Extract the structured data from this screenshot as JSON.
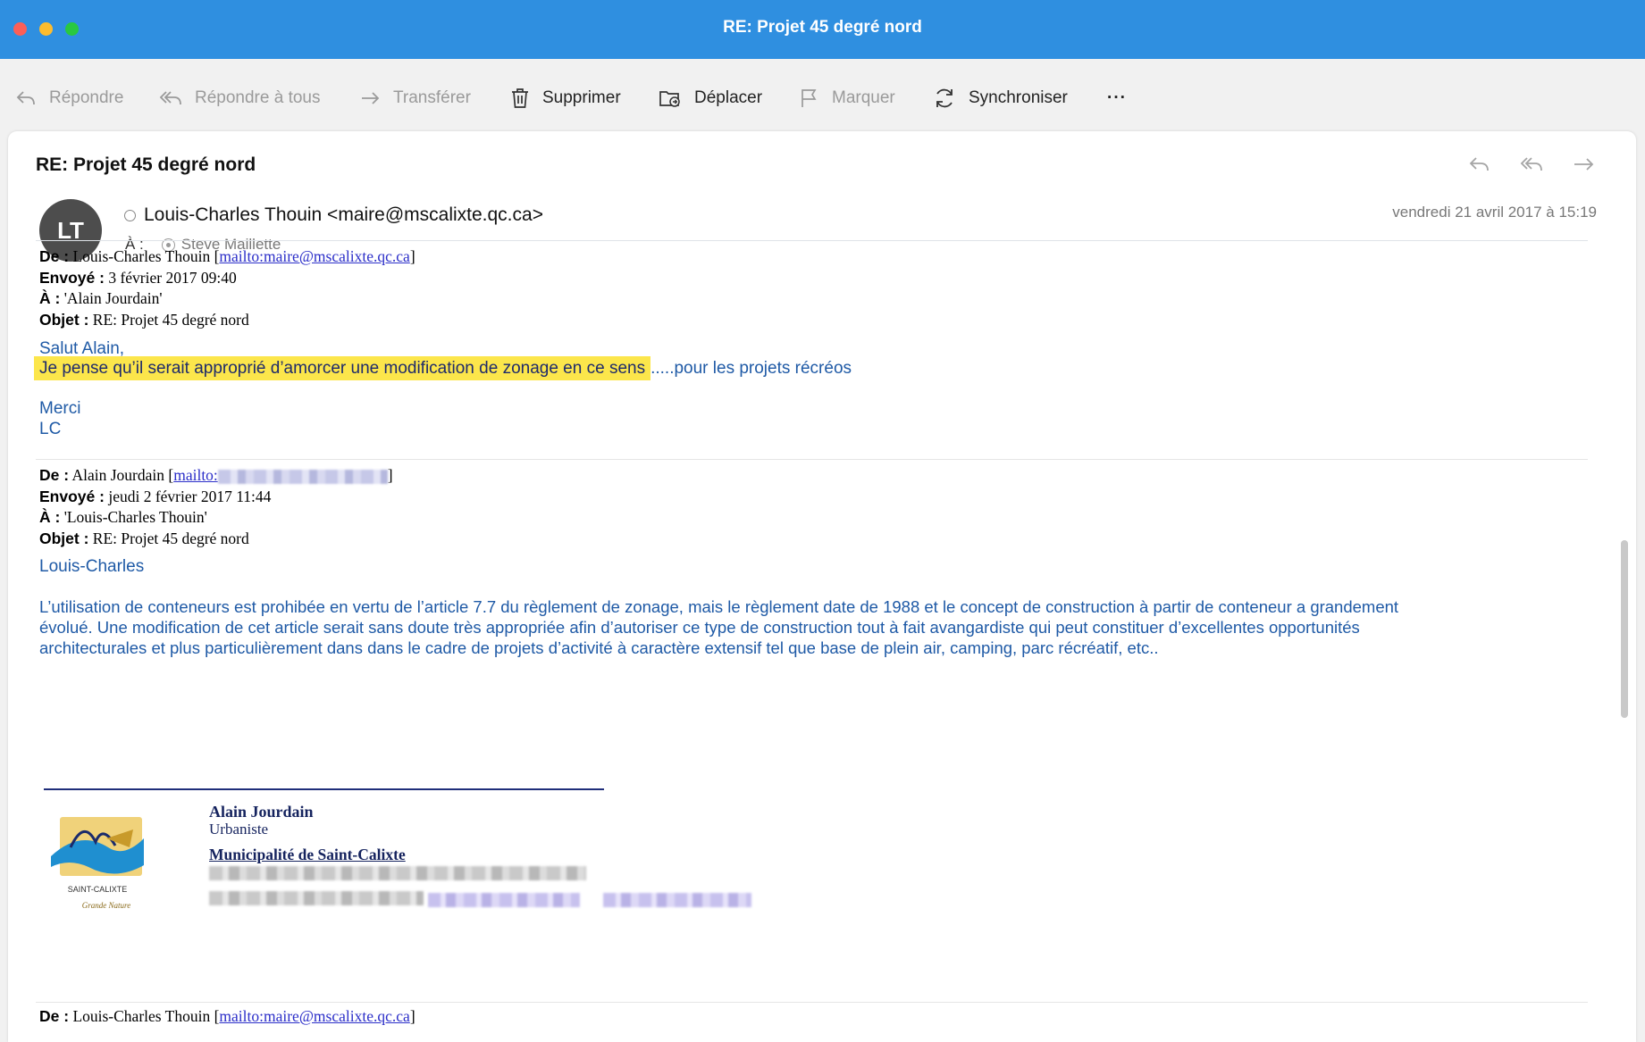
{
  "window": {
    "title": "RE: Projet 45 degré nord"
  },
  "toolbar": {
    "reply": "Répondre",
    "reply_all": "Répondre à tous",
    "forward": "Transférer",
    "delete": "Supprimer",
    "move": "Déplacer",
    "flag": "Marquer",
    "sync": "Synchroniser",
    "more": "···"
  },
  "message": {
    "subject": "RE: Projet 45 degré nord",
    "avatar_initials": "LT",
    "sender": "Louis-Charles Thouin <maire@mscalixte.qc.ca>",
    "to_label": "À :",
    "recipient": "Steve Maillette",
    "date": "vendredi 21 avril 2017 à 15:19"
  },
  "thread": {
    "first": {
      "from_label": "De :",
      "from_name": "Louis-Charles Thouin [",
      "from_link": "mailto:maire@mscalixte.qc.ca",
      "from_close": "]",
      "sent_label": "Envoyé :",
      "sent": "3 février 2017 09:40",
      "to_label": "À :",
      "to": "'Alain Jourdain'",
      "subject_label": "Objet :",
      "subject": "RE: Projet 45 degré nord",
      "greeting": "Salut Alain,",
      "highlight": "Je pense qu’il serait approprié d’amorcer une modification de zonage en ce sens",
      "rest": ".....pour les projets récréos",
      "thanks": "Merci",
      "sign": "LC"
    },
    "second": {
      "from_label": "De :",
      "from_name": "Alain Jourdain [",
      "from_link": "mailto:",
      "from_close": "]",
      "sent_label": "Envoyé :",
      "sent": "jeudi 2 février 2017 11:44",
      "to_label": "À :",
      "to": "'Louis-Charles Thouin'",
      "subject_label": "Objet :",
      "subject": "RE: Projet 45 degré nord",
      "greeting": "Louis-Charles",
      "line1": "L’utilisation de conteneurs est prohibée en vertu de l’article 7.7 du règlement de zonage, mais le règlement date de 1988 et le concept de construction à partir de conteneur a grandement",
      "line2": "évolué. Une modification de cet article serait sans doute très appropriée afin d’autoriser ce type de construction tout à fait avangardiste qui peut constituer d’excellentes opportunités",
      "line3": "architecturales et plus particulièrement dans dans le cadre de projets d’activité à caractère extensif tel que base de plein air, camping, parc récréatif, etc..",
      "sig_name": "Alain Jourdain",
      "sig_role": "Urbaniste",
      "sig_org": "Municipalité de Saint-Calixte",
      "logo_text": "SAINT-CALIXTE",
      "logo_script": "Grande Nature"
    },
    "third": {
      "from_label": "De :",
      "from_name": "Louis-Charles Thouin [",
      "from_link": "mailto:maire@mscalixte.qc.ca",
      "from_close": "]"
    }
  }
}
